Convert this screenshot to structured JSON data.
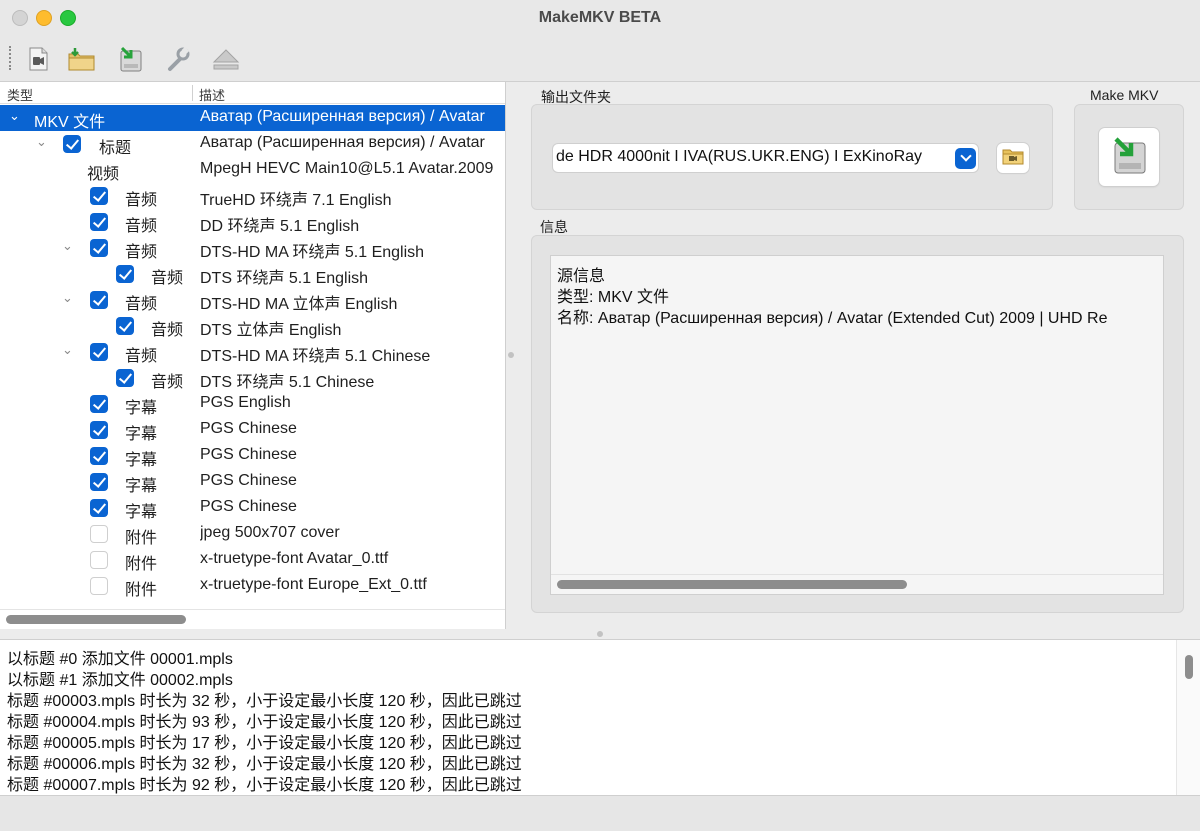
{
  "window": {
    "title": "MakeMKV BETA"
  },
  "toolbar": {
    "buttons": [
      {
        "icon": "open-file-icon"
      },
      {
        "icon": "open-folder-icon"
      },
      {
        "icon": "make-mkv-icon"
      },
      {
        "icon": "wrench-icon"
      },
      {
        "icon": "eject-icon"
      }
    ]
  },
  "tree": {
    "columns": {
      "type": "类型",
      "desc": "描述"
    },
    "rows": [
      {
        "type": "MKV 文件",
        "desc": "Аватар (Расширенная версия) / Avatar",
        "checked": null,
        "expanded": true,
        "selected": true
      },
      {
        "type": "标题",
        "desc": "Аватар (Расширенная версия) / Avatar",
        "checked": true,
        "expanded": true
      },
      {
        "type": "视频",
        "desc": "MpegH HEVC Main10@L5.1 Avatar.2009",
        "checked": null
      },
      {
        "type": "音频",
        "desc": "TrueHD 环绕声 7.1 English",
        "checked": true
      },
      {
        "type": "音频",
        "desc": "DD 环绕声 5.1 English",
        "checked": true
      },
      {
        "type": "音频",
        "desc": "DTS-HD MA 环绕声 5.1 English",
        "checked": true,
        "expanded": true
      },
      {
        "type": "音频",
        "desc": "DTS 环绕声 5.1 English",
        "checked": true
      },
      {
        "type": "音频",
        "desc": "DTS-HD MA 立体声 English",
        "checked": true,
        "expanded": true
      },
      {
        "type": "音频",
        "desc": "DTS 立体声 English",
        "checked": true
      },
      {
        "type": "音频",
        "desc": "DTS-HD MA 环绕声 5.1 Chinese",
        "checked": true,
        "expanded": true
      },
      {
        "type": "音频",
        "desc": "DTS 环绕声 5.1 Chinese",
        "checked": true
      },
      {
        "type": "字幕",
        "desc": "PGS English",
        "checked": true
      },
      {
        "type": "字幕",
        "desc": "PGS Chinese",
        "checked": true
      },
      {
        "type": "字幕",
        "desc": "PGS Chinese",
        "checked": true
      },
      {
        "type": "字幕",
        "desc": "PGS Chinese",
        "checked": true
      },
      {
        "type": "字幕",
        "desc": "PGS Chinese",
        "checked": true
      },
      {
        "type": "附件",
        "desc": "jpeg 500x707 cover",
        "checked": false
      },
      {
        "type": "附件",
        "desc": "x-truetype-font Avatar_0.ttf",
        "checked": false
      },
      {
        "type": "附件",
        "desc": "x-truetype-font Europe_Ext_0.ttf",
        "checked": false
      }
    ]
  },
  "output": {
    "label": "输出文件夹",
    "value": "de HDR 4000nit I IVA(RUS.UKR.ENG) I ExKinoRay"
  },
  "make_mkv": {
    "label": "Make MKV"
  },
  "info": {
    "label": "信息",
    "lines": [
      "源信息",
      "类型: MKV 文件",
      "名称: Аватар (Расширенная версия) / Avatar (Extended Cut) 2009 | UHD Re"
    ]
  },
  "log": {
    "lines": [
      "以标题 #0 添加文件 00001.mpls",
      "以标题 #1 添加文件 00002.mpls",
      "标题 #00003.mpls 时长为 32 秒，小于设定最小长度 120 秒，因此已跳过",
      "标题 #00004.mpls 时长为 93 秒，小于设定最小长度 120 秒，因此已跳过",
      "标题 #00005.mpls 时长为 17 秒，小于设定最小长度 120 秒，因此已跳过",
      "标题 #00006.mpls 时长为 32 秒，小于设定最小长度 120 秒，因此已跳过",
      "标题 #00007.mpls 时长为 92 秒，小于设定最小长度 120 秒，因此已跳过"
    ]
  }
}
